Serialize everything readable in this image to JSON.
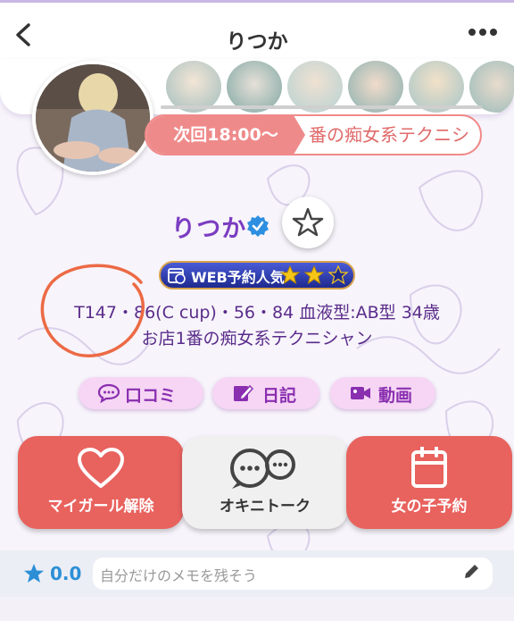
{
  "header": {
    "title": "りつか"
  },
  "profile": {
    "next_label": "次回18:00〜",
    "catchphrase_partial": "番の痴女系テクニシ",
    "name": "りつか",
    "web_badge": "WEB予約人気",
    "web_stars": 2,
    "web_stars_max": 3,
    "stats": "T147・86(C cup)・56・84 血液型:AB型 34歳",
    "catchphrase": "お店1番の痴女系テクニシャン"
  },
  "pills": {
    "reviews": "口コミ",
    "diary": "日記",
    "video": "動画"
  },
  "actions": {
    "my_girl": "マイガール解除",
    "talk": "オキニトーク",
    "reserve": "女の子予約"
  },
  "memo": {
    "rating": "0.0",
    "placeholder": "自分だけのメモを残そう"
  },
  "colors": {
    "accent_purple": "#7b3dc1",
    "action_red": "#e8625e",
    "pill_pink": "#f6d6f4",
    "rating_blue": "#2c8fd6"
  }
}
